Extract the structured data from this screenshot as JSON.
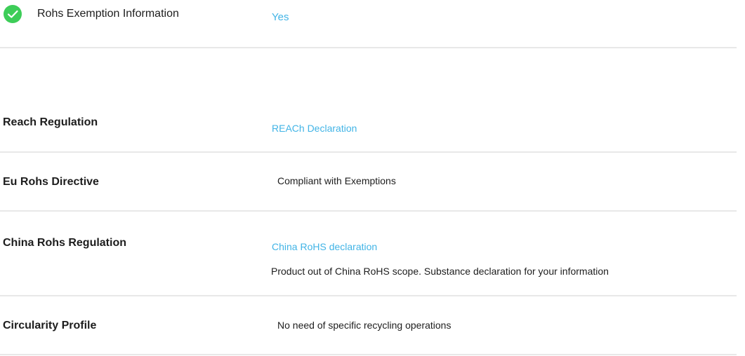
{
  "rohs_exemption": {
    "icon": "check-circle-icon",
    "label": "Rohs Exemption Information",
    "value": "Yes"
  },
  "rows": [
    {
      "label": "Reach Regulation",
      "link": "REACh Declaration"
    },
    {
      "label": "Eu Rohs Directive",
      "value": "Compliant with Exemptions"
    },
    {
      "label": "China Rohs Regulation",
      "link": "China RoHS declaration",
      "note": "Product out of China RoHS scope. Substance declaration for your information"
    },
    {
      "label": "Circularity Profile",
      "value": "No need of specific recycling operations"
    }
  ],
  "colors": {
    "accent_link": "#42b4e6",
    "check_green": "#3dcd58",
    "divider": "#e8e8e8",
    "text": "#1d1d1d"
  }
}
